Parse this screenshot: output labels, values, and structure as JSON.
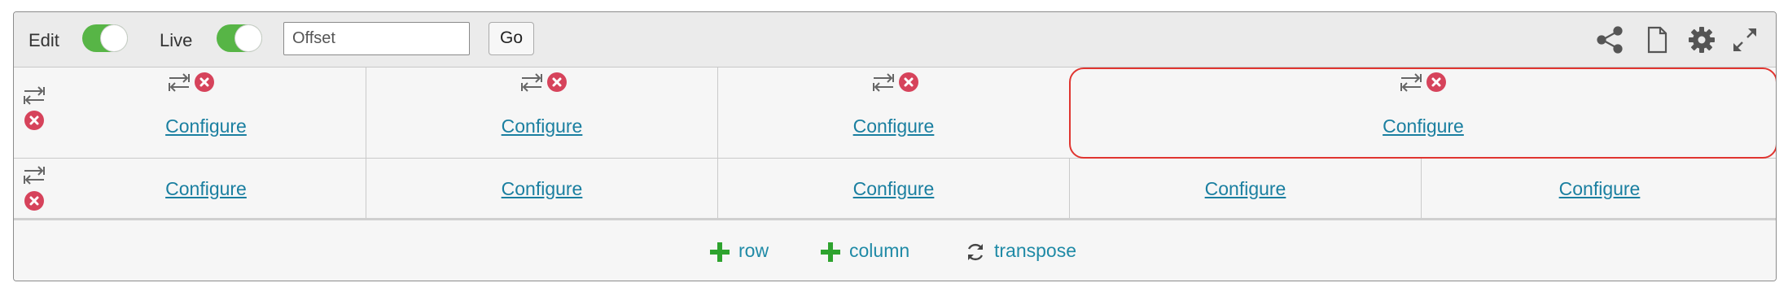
{
  "toolbar": {
    "edit_label": "Edit",
    "live_label": "Live",
    "offset_placeholder": "Offset",
    "go_label": "Go",
    "icons": [
      "share-icon",
      "document-icon",
      "gear-icon",
      "expand-icon"
    ]
  },
  "grid": {
    "rows": [
      {
        "cells": [
          {
            "label": "Configure"
          },
          {
            "label": "Configure"
          },
          {
            "label": "Configure"
          },
          {
            "label": "Configure"
          }
        ]
      },
      {
        "cells": [
          {
            "label": "Configure"
          },
          {
            "label": "Configure"
          },
          {
            "label": "Configure"
          },
          {
            "label": "Configure"
          },
          {
            "label": "Configure"
          }
        ]
      }
    ]
  },
  "footer": {
    "add_row_label": "row",
    "add_column_label": "column",
    "transpose_label": "transpose"
  },
  "colors": {
    "toggle_on": "#57b546",
    "link": "#1a7fa0",
    "remove": "#d6435b",
    "selected_border": "#e03530",
    "add_icon": "#2ea32e"
  }
}
